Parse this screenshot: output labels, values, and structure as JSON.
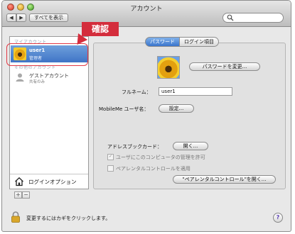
{
  "window": {
    "title": "アカウント"
  },
  "toolbar": {
    "back_label": "◀",
    "forward_label": "▶",
    "show_all_label": "すべてを表示",
    "search_placeholder": ""
  },
  "sidebar": {
    "my_account_label": "マイアカウント",
    "other_accounts_label": "その他のアカウント",
    "user": {
      "name": "user1",
      "role": "管理者"
    },
    "guest": {
      "name": "ゲストアカウント",
      "status": "共有のみ"
    },
    "login_options_label": "ログインオプション",
    "add_label": "+",
    "remove_label": "−"
  },
  "callout": {
    "label": "確認",
    "color": "#d42d3c"
  },
  "tabs": [
    {
      "label": "パスワード",
      "selected": true
    },
    {
      "label": "ログイン項目",
      "selected": false
    }
  ],
  "password": {
    "change_button": "パスワードを変更...",
    "fullname_label": "フルネーム：",
    "fullname_value": "user1",
    "mobileme_label": "MobileMe ユーザ名：",
    "mobileme_button": "設定...",
    "addressbook_label": "アドレスブックカード：",
    "addressbook_button": "開く...",
    "allow_admin_label": "ユーザにこのコンピュータの管理を許可",
    "parental_label": "ペアレンタルコントロールを適用",
    "parental_button": "\"ペアレンタルコントロール\"を開く..."
  },
  "footer": {
    "lock_text": "変更するにはカギをクリックします。",
    "help_label": "?"
  },
  "colors": {
    "accent": "#3f74c6",
    "callout": "#d42d3c"
  },
  "icons": [
    "lock-icon",
    "help-icon",
    "search-icon",
    "house-icon",
    "guest-user-icon",
    "user-avatar-icon"
  ]
}
